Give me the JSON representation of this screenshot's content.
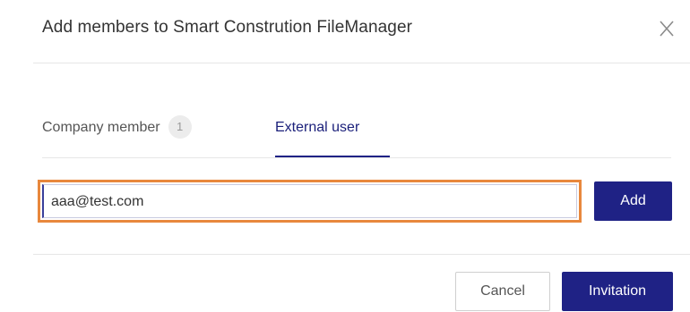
{
  "dialog": {
    "title": "Add members to Smart Constrution FileManager",
    "close_icon": "close-icon"
  },
  "tabs": [
    {
      "label": "Company member",
      "badge": "1",
      "active": false
    },
    {
      "label": "External user",
      "active": true
    }
  ],
  "email_input": {
    "value": "aaa@test.com",
    "placeholder": ""
  },
  "buttons": {
    "add_label": "Add",
    "cancel_label": "Cancel",
    "invite_label": "Invitation"
  },
  "colors": {
    "primary": "#1f2285",
    "focus_highlight": "#e8883d",
    "badge_bg": "#ececec"
  }
}
